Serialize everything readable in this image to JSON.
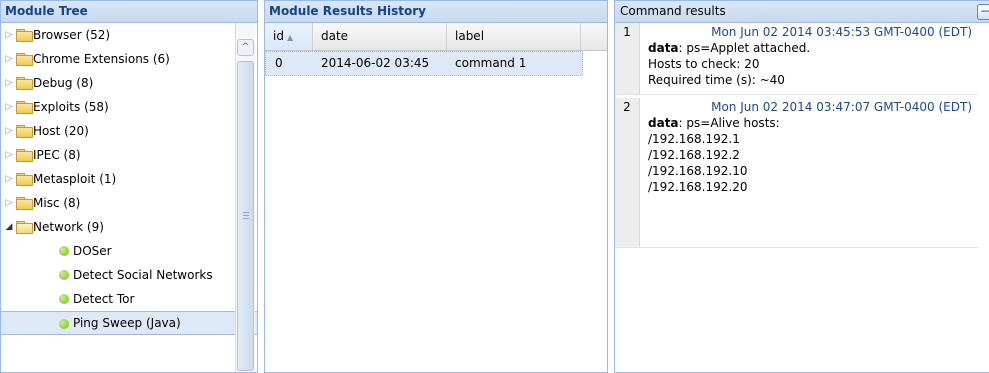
{
  "module_tree": {
    "title": "Module Tree",
    "items": [
      {
        "type": "folder",
        "label": "Browser (52)",
        "expanded": false
      },
      {
        "type": "folder",
        "label": "Chrome Extensions (6)",
        "expanded": false
      },
      {
        "type": "folder",
        "label": "Debug (8)",
        "expanded": false
      },
      {
        "type": "folder",
        "label": "Exploits (58)",
        "expanded": false
      },
      {
        "type": "folder",
        "label": "Host (20)",
        "expanded": false
      },
      {
        "type": "folder",
        "label": "IPEC (8)",
        "expanded": false
      },
      {
        "type": "folder",
        "label": "Metasploit (1)",
        "expanded": false
      },
      {
        "type": "folder",
        "label": "Misc (8)",
        "expanded": false
      },
      {
        "type": "folder",
        "label": "Network (9)",
        "expanded": true
      },
      {
        "type": "module",
        "label": "DOSer"
      },
      {
        "type": "module",
        "label": "Detect Social Networks"
      },
      {
        "type": "module",
        "label": "Detect Tor"
      },
      {
        "type": "module",
        "label": "Ping Sweep (Java)",
        "selected": true
      }
    ]
  },
  "history": {
    "title": "Module Results History",
    "columns": {
      "id": "id",
      "date": "date",
      "label": "label"
    },
    "rows": [
      {
        "id": "0",
        "date": "2014-06-02 03:45",
        "label": "command 1"
      }
    ]
  },
  "command_results": {
    "title": "Command results",
    "collapse_symbol": "−",
    "data_key": "data",
    "entries": [
      {
        "num": "1",
        "time": "Mon Jun 02 2014 03:45:53 GMT-0400 (EDT)",
        "first_line": ": ps=Applet attached.",
        "lines": [
          "Hosts to check: 20",
          "Required time (s): ~40"
        ]
      },
      {
        "num": "2",
        "time": "Mon Jun 02 2014 03:47:07 GMT-0400 (EDT)",
        "first_line": ": ps=Alive hosts:",
        "lines": [
          "/192.168.192.1",
          "/192.168.192.2",
          "/192.168.192.10",
          "/192.168.192.20"
        ]
      }
    ]
  },
  "colors": {
    "header_bg": "#c7d9ef",
    "header_text": "#15428b",
    "selection": "#dfe8f6",
    "timestamp": "#1c48a5",
    "module_status": "#6fbf2a"
  }
}
